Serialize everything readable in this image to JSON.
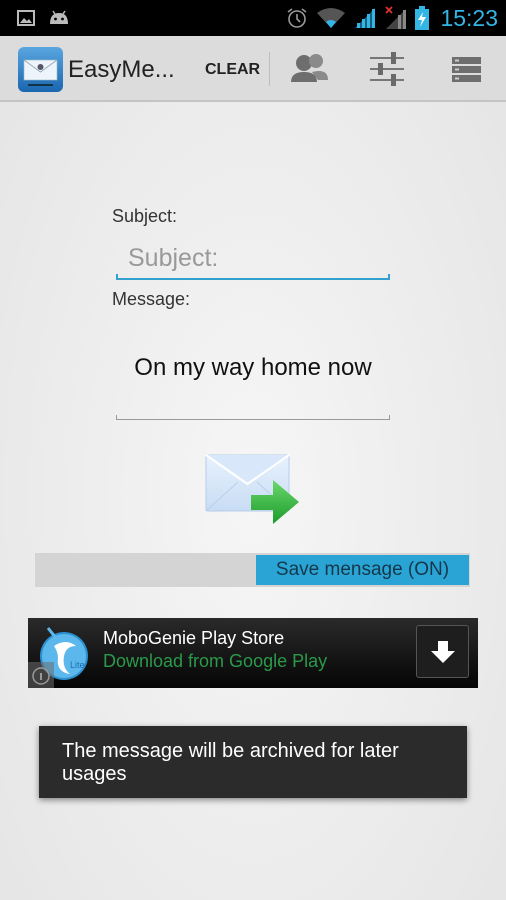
{
  "status_bar": {
    "left_icons": [
      "gallery-icon",
      "android-icon"
    ],
    "right_icons": [
      "alarm-icon",
      "wifi-icon",
      "signal-icon",
      "signal-no-data-icon",
      "battery-charging-icon"
    ],
    "time": "15:23"
  },
  "action_bar": {
    "app_icon": "envelope-app-icon",
    "title": "EasyMe...",
    "clear_label": "CLEAR",
    "actions": [
      "contacts-icon",
      "settings-sliders-icon",
      "list-icon"
    ]
  },
  "form": {
    "subject_label": "Subject:",
    "subject_placeholder": "Subject:",
    "subject_value": "",
    "message_label": "Message:",
    "message_value": "On my way home now"
  },
  "send_button": {
    "icon": "send-mail-icon"
  },
  "save_toggle": {
    "label": "Save mensage (ON)",
    "state": "on"
  },
  "ad": {
    "title": "MoboGenie Play Store",
    "subtitle": "Download from Google Play",
    "logo_badge": "Lite",
    "download_icon": "download-arrow-icon",
    "info_icon": "info-icon"
  },
  "toast": {
    "text": "The message will be archived for later usages"
  },
  "colors": {
    "accent": "#33b5e5",
    "toggle_on": "#2aa4d4",
    "ad_subtitle": "#2a9a4a"
  }
}
